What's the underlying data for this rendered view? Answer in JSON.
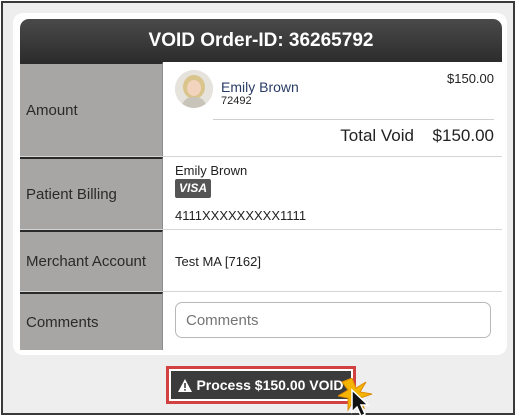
{
  "title": "VOID Order-ID: 36265792",
  "amount": {
    "label": "Amount",
    "customer_name": "Emily Brown",
    "customer_id": "72492",
    "line_amount": "$150.00",
    "total_label": "Total Void",
    "total_value": "$150.00"
  },
  "billing": {
    "label": "Patient Billing",
    "name": "Emily Brown",
    "card_brand": "VISA",
    "card_number": "4111XXXXXXXXX1111"
  },
  "merchant": {
    "label": "Merchant Account",
    "value": "Test MA [7162]"
  },
  "comments": {
    "label": "Comments",
    "placeholder": "Comments"
  },
  "action": {
    "icon": "warning-icon",
    "label": "Process $150.00 VOID"
  },
  "colors": {
    "header_bg": "#333333",
    "label_bg": "#a8a6a4",
    "highlight": "#d24141",
    "link": "#2a3d66"
  }
}
